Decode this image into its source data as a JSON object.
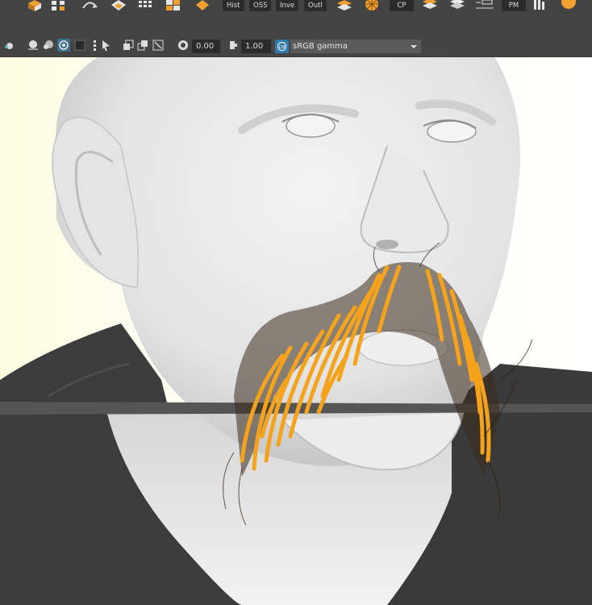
{
  "shelf": {
    "buttons": [
      "Hist",
      "OSS",
      "Inve",
      "Outl",
      "CP",
      "PM"
    ],
    "icons": [
      "cube-orange-icon",
      "cubes-stack-icon",
      "uv-grid-icon",
      "rotate-arrow-icon",
      "diamond-icon",
      "grid-icon",
      "orange-cube-icon",
      "orange-square-icon",
      "layered-diamonds-icon",
      "sphere-lattice-icon",
      "stack-icon",
      "layers-icon",
      "box-lines-icon",
      "panel-icon",
      "circle-dot-icon"
    ]
  },
  "panel_toolbar": {
    "exposure_value": "0.00",
    "gamma_value": "1.00",
    "color_space": "sRGB gamma",
    "icons": [
      "light-icon",
      "shaded-sphere-icon",
      "textured-sphere-icon",
      "isolate-icon",
      "dark-square-icon",
      "dots-icon",
      "cursor-icon",
      "copy-icon",
      "copy-alt-icon",
      "expand-icon",
      "exposure-icon",
      "gamma-icon",
      "color-management-icon",
      "dropdown-arrow-icon"
    ]
  },
  "viewport": {
    "content": "3D head model with orange mustache hair strands",
    "colors": {
      "background_left": "#fdfde0",
      "background_right": "#ffffff",
      "skin": "#e6e6e6",
      "jacket": "#3c3c3c",
      "hair_accent": "#f5a21c",
      "hair_dark": "#3a2a1a",
      "ground_line": "#555555"
    }
  }
}
